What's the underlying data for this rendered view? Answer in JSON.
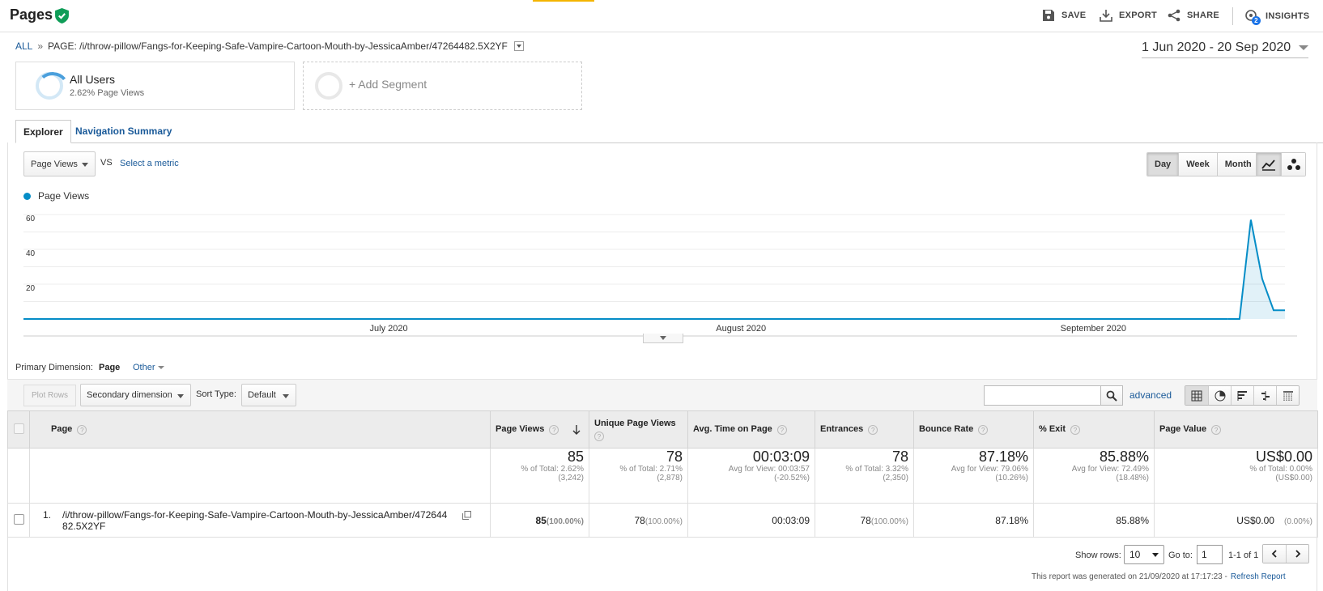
{
  "header": {
    "title": "Pages",
    "actions": [
      {
        "label": "SAVE",
        "icon": "save-icon"
      },
      {
        "label": "EXPORT",
        "icon": "export-icon"
      },
      {
        "label": "SHARE",
        "icon": "share-icon"
      },
      {
        "label": "INSIGHTS",
        "icon": "insights-icon",
        "badge": "2"
      }
    ]
  },
  "breadcrumb": {
    "all": "ALL",
    "sep": "»",
    "page": "PAGE: /i/throw-pillow/Fangs-for-Keeping-Safe-Vampire-Cartoon-Mouth-by-JessicaAmber/47264482.5X2YF"
  },
  "date_range": "1 Jun 2020 - 20 Sep 2020",
  "segments": {
    "active": {
      "name": "All Users",
      "sub": "2.62% Page Views"
    },
    "add": "+ Add Segment"
  },
  "tabs": [
    "Explorer",
    "Navigation Summary"
  ],
  "chart_controls": {
    "metric": "Page Views",
    "vs": "VS",
    "select_metric": "Select a metric",
    "periods": [
      "Day",
      "Week",
      "Month"
    ],
    "active_period": "Day"
  },
  "chart_data": {
    "type": "line",
    "series": [
      {
        "name": "Page Views",
        "color": "#058dc7",
        "x": [
          "2020-09-15",
          "2020-09-16",
          "2020-09-17",
          "2020-09-18",
          "2020-09-19",
          "2020-09-20"
        ],
        "values": [
          0,
          0,
          57,
          23,
          5,
          5
        ]
      }
    ],
    "yticks": [
      20,
      40,
      60
    ],
    "ylim": [
      0,
      60
    ],
    "xticks": [
      "July 2020",
      "August 2020",
      "September 2020"
    ],
    "xrange": [
      "2020-06-01",
      "2020-09-20"
    ],
    "baseline_value": 0,
    "legend": "top-left"
  },
  "primary_dimension": {
    "label": "Primary Dimension:",
    "value": "Page",
    "other": "Other"
  },
  "toolbar": {
    "plot_rows": "Plot Rows",
    "secondary_dimension": "Secondary dimension",
    "sort_type_label": "Sort Type:",
    "sort_type": "Default",
    "advanced": "advanced"
  },
  "table": {
    "columns": [
      "Page",
      "Page Views",
      "Unique Page Views",
      "Avg. Time on Page",
      "Entrances",
      "Bounce Rate",
      "% Exit",
      "Page Value"
    ],
    "totals": [
      {
        "big": "85",
        "l1": "% of Total: 2.62%",
        "l2": "(3,242)"
      },
      {
        "big": "78",
        "l1": "% of Total: 2.71%",
        "l2": "(2,878)"
      },
      {
        "big": "00:03:09",
        "l1": "Avg for View: 00:03:57",
        "l2": "(-20.52%)"
      },
      {
        "big": "78",
        "l1": "% of Total: 3.32%",
        "l2": "(2,350)"
      },
      {
        "big": "87.18%",
        "l1": "Avg for View: 79.06%",
        "l2": "(10.26%)"
      },
      {
        "big": "85.88%",
        "l1": "Avg for View: 72.49%",
        "l2": "(18.48%)"
      },
      {
        "big": "US$0.00",
        "l1": "% of Total: 0.00%",
        "l2": "(US$0.00)"
      }
    ],
    "rows": [
      {
        "num": "1.",
        "page": "/i/throw-pillow/Fangs-for-Keeping-Safe-Vampire-Cartoon-Mouth-by-JessicaAmber/47264482.5X2YF",
        "page_views": "85",
        "page_views_pct": "(100.00%)",
        "unique": "78",
        "unique_pct": "(100.00%)",
        "avg_time": "00:03:09",
        "entrances": "78",
        "entrances_pct": "(100.00%)",
        "bounce": "87.18%",
        "exit": "85.88%",
        "value": "US$0.00",
        "value_pct": "(0.00%)"
      }
    ]
  },
  "footer": {
    "show_rows_label": "Show rows:",
    "show_rows": "10",
    "goto_label": "Go to:",
    "goto": "1",
    "range": "1-1 of 1",
    "generated": "This report was generated on 21/09/2020 at 17:17:23 -",
    "refresh": "Refresh Report"
  }
}
